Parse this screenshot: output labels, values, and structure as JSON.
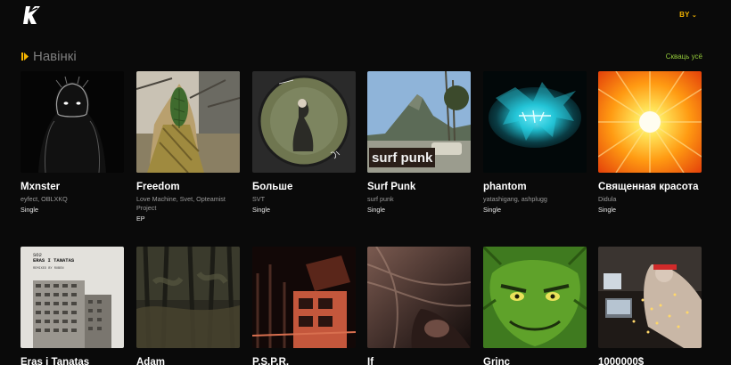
{
  "header": {
    "lang": "BY"
  },
  "section": {
    "title": "Навінкі",
    "see_all": "Скваць усё"
  },
  "row1": [
    {
      "title": "Mxnster",
      "artists": "eyfect, OBLXKQ",
      "type": "Single"
    },
    {
      "title": "Freedom",
      "artists": "Love Machine, Svet, Opteamist Project",
      "type": "EP"
    },
    {
      "title": "Больше",
      "artists": "SVT",
      "type": "Single"
    },
    {
      "title": "Surf Punk",
      "artists": "surf punk",
      "type": "Single",
      "cover_text": "surf punk"
    },
    {
      "title": "phantom",
      "artists": "yatashigang, ashplugg",
      "type": "Single"
    },
    {
      "title": "Священная красота",
      "artists": "Didula",
      "type": "Single"
    }
  ],
  "row2": [
    {
      "title": "Eras i Tanatas",
      "cover_text_1": "SO2",
      "cover_text_2": "ERAS I TANATAS",
      "cover_text_3": "REMIXED BY RUBEN"
    },
    {
      "title": "Adam"
    },
    {
      "title": "P.S.P.R."
    },
    {
      "title": "If"
    },
    {
      "title": "Grinc"
    },
    {
      "title": "1000000$"
    }
  ]
}
